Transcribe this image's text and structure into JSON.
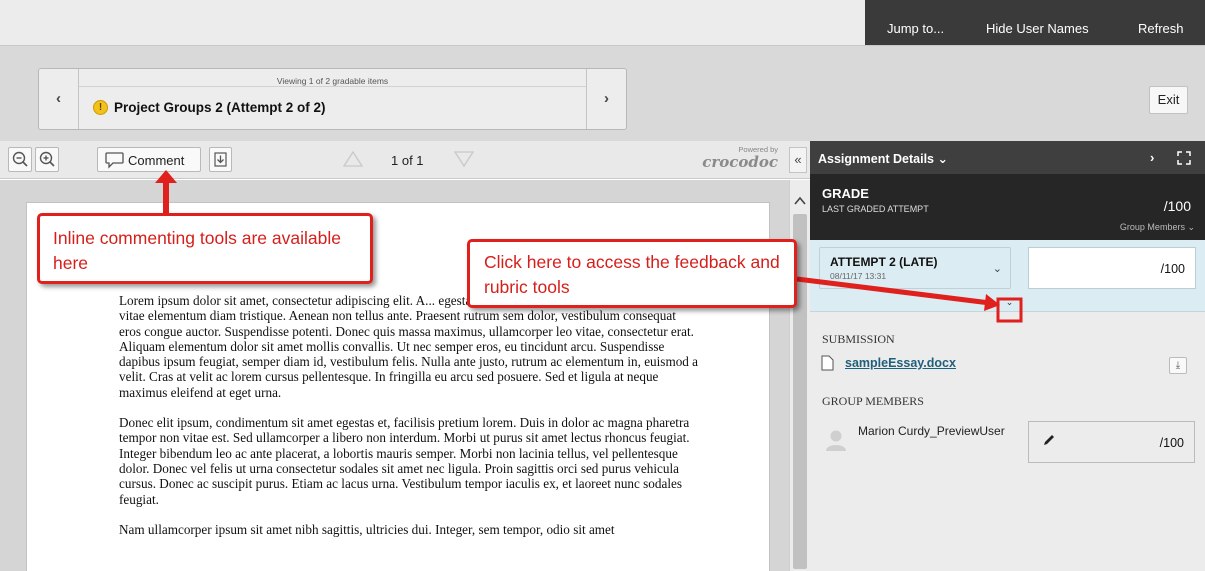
{
  "topnav": {
    "jump_label": "Jump to...",
    "hide_names_label": "Hide User Names",
    "refresh_label": "Refresh"
  },
  "gradable": {
    "viewing_text": "Viewing 1 of 2 gradable items",
    "title": "Project Groups 2 (Attempt 2 of 2)",
    "prev_glyph": "‹",
    "next_glyph": "›",
    "status_icon": "warning-icon"
  },
  "exit_label": "Exit",
  "doc_toolbar": {
    "comment_label": "Comment",
    "page_count": "1 of 1",
    "powered_by": "Powered by",
    "brand": "crocodoc",
    "collapse_glyph": "«"
  },
  "document": {
    "paragraphs": [
      "Lorem ipsum dolor sit amet, consectetur adipiscing elit. A... egestas. Quisque lobortis nibh in elit pharetra, vitae elementum diam tristique. Aenean non tellus ante. Praesent rutrum sem dolor, vestibulum consequat eros congue auctor. Suspendisse potenti. Donec quis massa maximus, ullamcorper leo vitae, consectetur erat. Aliquam elementum dolor sit amet mollis convallis. Ut nec semper eros, eu tincidunt arcu. Suspendisse dapibus ipsum feugiat, semper diam id, vestibulum felis. Nulla ante justo, rutrum ac elementum in, euismod a velit. Cras at velit ac lorem cursus pellentesque. In fringilla eu arcu sed posuere. Sed et ligula at neque maximus eleifend at eget urna.",
      "Donec elit ipsum, condimentum sit amet egestas et, facilisis pretium lorem. Duis in dolor ac magna pharetra tempor non vitae est. Sed ullamcorper a libero non interdum. Morbi ut purus sit amet lectus rhoncus feugiat. Integer bibendum leo ac ante placerat, a lobortis mauris semper. Morbi non lacinia tellus, vel pellentesque dolor. Donec vel felis ut urna consectetur sodales sit amet nec ligula. Proin sagittis orci sed purus vehicula cursus. Donec ac suscipit purus. Etiam ac lacus urna. Vestibulum tempor iaculis ex, et laoreet nunc sodales feugiat.",
      "Nam ullamcorper ipsum sit amet nibh sagittis, ultricies dui. Integer, sem tempor, odio sit amet"
    ]
  },
  "panel": {
    "title": "Assignment Details ⌄",
    "next_glyph": "›",
    "grade": {
      "label": "GRADE",
      "sub": "LAST GRADED ATTEMPT",
      "value": "/100",
      "group_members": "Group Members ⌄"
    },
    "attempt": {
      "title": "ATTEMPT 2 (LATE)",
      "date": "08/11/17 13:31",
      "chevron": "⌄",
      "value": "/100",
      "toggle": "⌄"
    },
    "submission_header": "SUBMISSION",
    "file_name": "sampleEssay.docx",
    "download_glyph": "⤓",
    "group_header": "GROUP MEMBERS",
    "member_name": "Marion Curdy_PreviewUser",
    "member_value": "/100"
  },
  "annotations": {
    "callout1": "Inline commenting tools are available here",
    "callout2": "Click here to access the feedback and rubric tools"
  },
  "colors": {
    "callout_red": "#e0201c",
    "panel_dark": "#262626",
    "attempt_bg": "#dcecf3",
    "link": "#1f5f7b"
  }
}
